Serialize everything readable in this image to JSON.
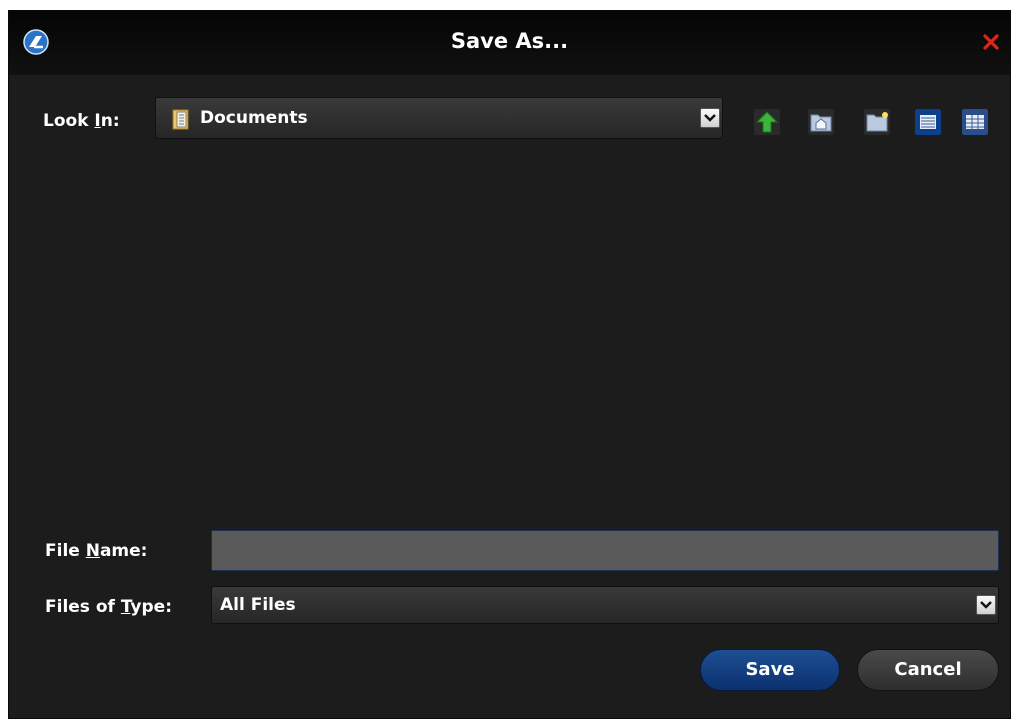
{
  "dialog": {
    "title": "Save As...",
    "close_icon": "close-icon"
  },
  "look_in": {
    "label_pre": "Look ",
    "label_accel": "I",
    "label_post": "n:",
    "value": "Documents",
    "icon": "folder-icon"
  },
  "toolbar": {
    "up_icon": "up-folder-icon",
    "home_icon": "home-folder-icon",
    "new_folder_icon": "new-folder-icon",
    "list_view_icon": "list-view-icon",
    "details_view_icon": "details-view-icon"
  },
  "file_name": {
    "label_pre": "File ",
    "label_accel": "N",
    "label_post": "ame:",
    "value": ""
  },
  "file_type": {
    "label_pre": "Files of ",
    "label_accel": "T",
    "label_post": "ype:",
    "value": "All Files"
  },
  "buttons": {
    "save_label": "Save",
    "cancel_label": "Cancel"
  },
  "colors": {
    "background": "#1c1c1c",
    "accent": "#0b3170",
    "close": "#e0241a"
  }
}
